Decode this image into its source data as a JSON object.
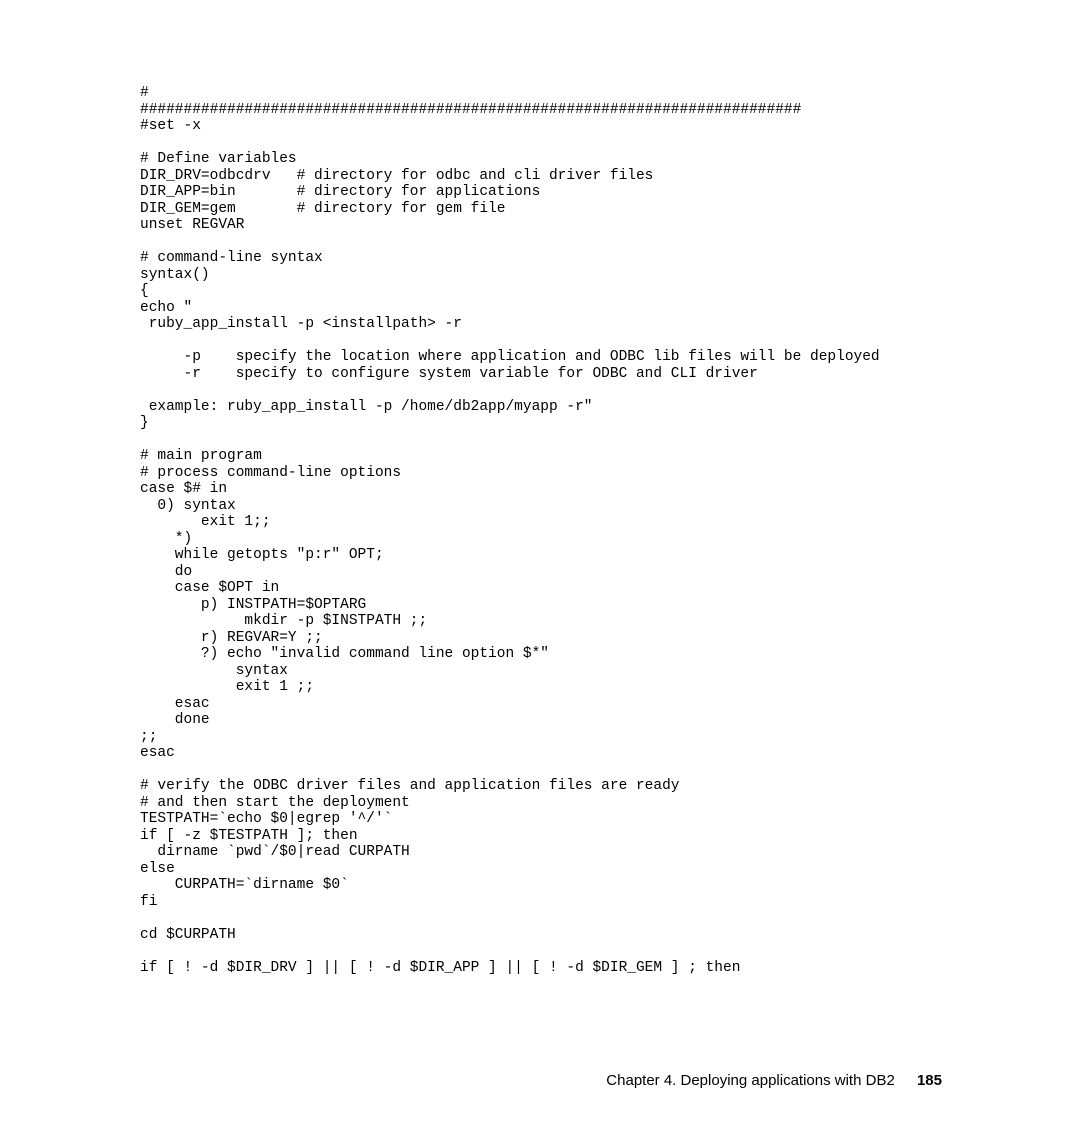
{
  "code": {
    "lines": [
      "#",
      "############################################################################",
      "#set -x",
      "",
      "# Define variables",
      "DIR_DRV=odbcdrv   # directory for odbc and cli driver files",
      "DIR_APP=bin       # directory for applications",
      "DIR_GEM=gem       # directory for gem file",
      "unset REGVAR",
      "",
      "# command-line syntax",
      "syntax()",
      "{",
      "echo \"",
      " ruby_app_install -p <installpath> -r",
      "",
      "     -p    specify the location where application and ODBC lib files will be deployed",
      "     -r    specify to configure system variable for ODBC and CLI driver",
      "",
      " example: ruby_app_install -p /home/db2app/myapp -r\"",
      "}",
      "",
      "# main program",
      "# process command-line options",
      "case $# in",
      "  0) syntax",
      "       exit 1;;",
      "    *)",
      "    while getopts \"p:r\" OPT;",
      "    do",
      "    case $OPT in",
      "       p) INSTPATH=$OPTARG",
      "            mkdir -p $INSTPATH ;;",
      "       r) REGVAR=Y ;;",
      "       ?) echo \"invalid command line option $*\"",
      "           syntax",
      "           exit 1 ;;",
      "    esac",
      "    done",
      ";;",
      "esac",
      "",
      "# verify the ODBC driver files and application files are ready",
      "# and then start the deployment",
      "TESTPATH=`echo $0|egrep '^/'`",
      "if [ -z $TESTPATH ]; then",
      "  dirname `pwd`/$0|read CURPATH",
      "else",
      "    CURPATH=`dirname $0`",
      "fi",
      "",
      "cd $CURPATH",
      "",
      "if [ ! -d $DIR_DRV ] || [ ! -d $DIR_APP ] || [ ! -d $DIR_GEM ] ; then"
    ]
  },
  "footer": {
    "chapter": "Chapter 4. Deploying applications with DB2",
    "page": "185"
  }
}
